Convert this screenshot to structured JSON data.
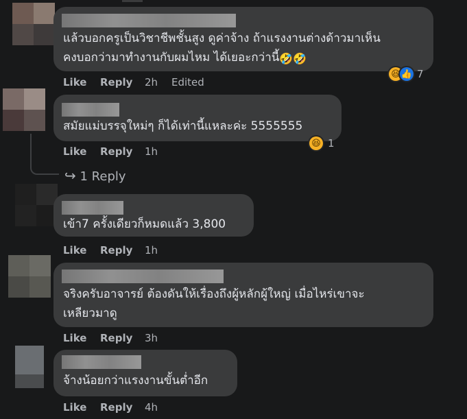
{
  "comments": [
    {
      "text_lines": [
        "แล้วบอกครูเป็นวิชาชีพชั้นสูง ดูค่าจ้าง ถ้าแรงงานต่างด้าวมาเห็น",
        "คงบอกว่ามาทำงานกับผมไหม ได้เยอะกว่านี้"
      ],
      "emoji": "🤣🤣",
      "like": "Like",
      "reply": "Reply",
      "time": "2h",
      "edited": "Edited",
      "reaction_count": "7"
    },
    {
      "text_lines": [
        "สมัยแม่บรรจุใหม่ๆ ก็ได้เท่านี้แหละค่ะ 5555555"
      ],
      "like": "Like",
      "reply": "Reply",
      "time": "1h",
      "reaction_count": "1"
    },
    {
      "text_lines": [
        "เข้า7 ครั้งเดียวก็หมดแล้ว 3,800"
      ],
      "like": "Like",
      "reply": "Reply",
      "time": "1h"
    },
    {
      "text_lines": [
        "จริงครับอาจารย์ ต้องดันให้เรื่องถึงผู้หลักผู้ใหญ่ เมื่อไหร่เขาจะ",
        "เหลียวมาดู"
      ],
      "like": "Like",
      "reply": "Reply",
      "time": "3h"
    },
    {
      "text_lines": [
        "จ้างน้อยกว่าแรงงานขั้นต่ำอีก"
      ],
      "like": "Like",
      "reply": "Reply",
      "time": "4h"
    }
  ],
  "replies_link": {
    "arrow": "↪",
    "label": "1 Reply"
  },
  "icons": {
    "haha": "haha-reaction-icon",
    "like": "like-reaction-icon"
  },
  "colors": {
    "background": "#18191a",
    "bubble": "#3a3b3c",
    "text": "#e4e6eb",
    "meta": "#b0b3b8",
    "reaction_haha": "#f7b125",
    "reaction_like": "#1b74e4"
  }
}
